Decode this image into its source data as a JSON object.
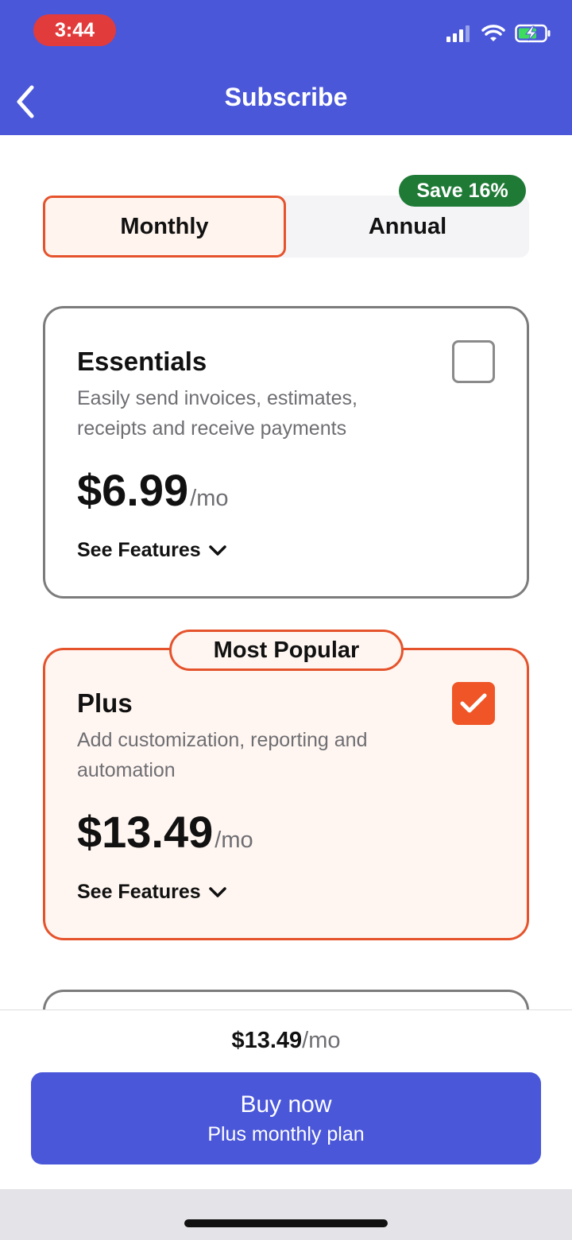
{
  "status_bar": {
    "time": "3:44",
    "icons": [
      "signal-icon",
      "wifi-icon",
      "battery-charging-icon"
    ]
  },
  "header": {
    "title": "Subscribe",
    "back_icon": "chevron-left-icon",
    "background": "#4a57d9"
  },
  "billing_toggle": {
    "options": [
      "Monthly",
      "Annual"
    ],
    "selected": "Monthly",
    "save_badge": "Save 16%"
  },
  "plans": [
    {
      "name": "Essentials",
      "description": "Easily send invoices, estimates, receipts and receive payments",
      "price": "$6.99",
      "unit": "/mo",
      "see_features": "See Features",
      "selected": false
    },
    {
      "badge": "Most Popular",
      "name": "Plus",
      "description": "Add customization, reporting and automation",
      "price": "$13.49",
      "unit": "/mo",
      "see_features": "See Features",
      "selected": true
    }
  ],
  "footer": {
    "price": "$13.49",
    "unit": "/mo",
    "buy_label": "Buy now",
    "buy_sublabel": "Plus monthly plan"
  },
  "colors": {
    "accent": "#e5532c",
    "primary": "#4a57d9",
    "save_badge": "#1f7a36"
  }
}
